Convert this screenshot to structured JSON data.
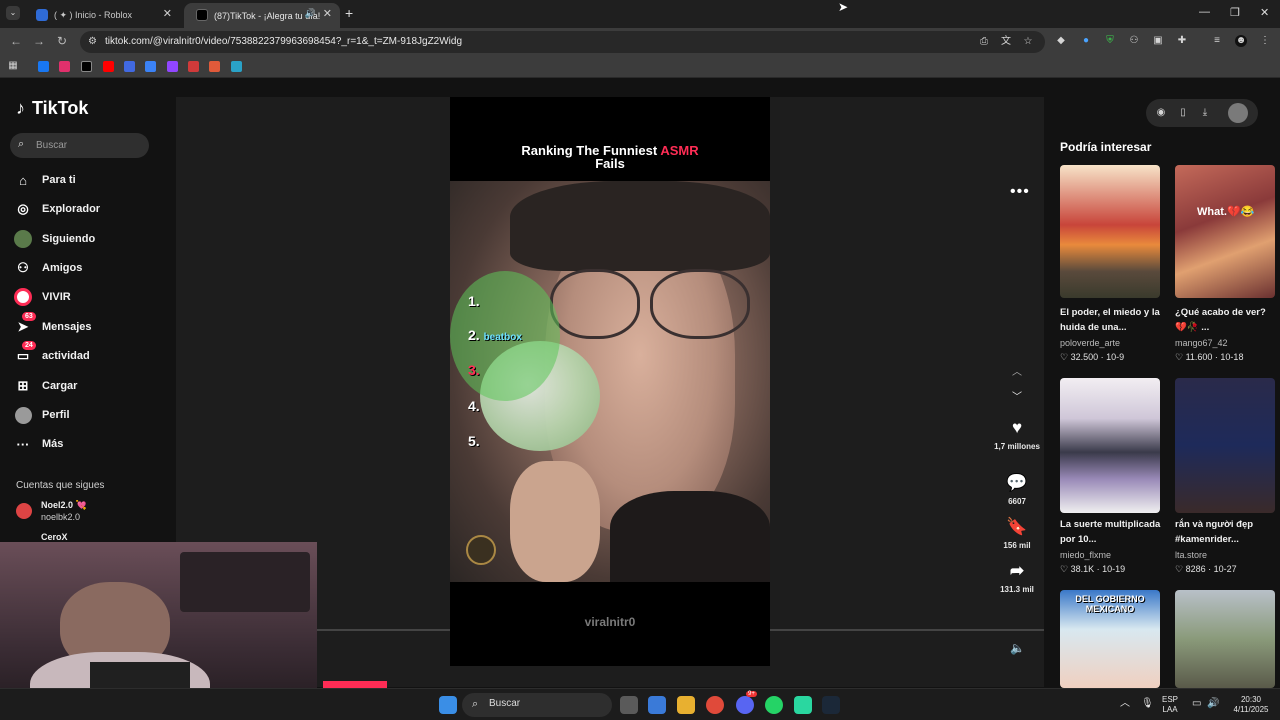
{
  "browser": {
    "tabs": [
      {
        "title": "( ✦ ) Inicio - Roblox",
        "fav_color": "#2f6bd6"
      },
      {
        "title": "(87)TikTok - ¡Alegra tu día!",
        "fav_color": "#000000"
      }
    ],
    "new_tab": "+",
    "url": "tiktok.com/@viralnitr0/video/7538822379963698454?_r=1&_t=ZM-918JgZ2Widg",
    "bookmark_colors": [
      "#1877f2",
      "#e1306c",
      "#000000",
      "#ff0000",
      "#4169e1",
      "#3b82f6",
      "#9146ff",
      "#d03a3a",
      "#e05a3a",
      "#2aa2c7"
    ]
  },
  "tiktok": {
    "logo": "TikTok",
    "search_placeholder": "Buscar",
    "nav": [
      {
        "label": "Para ti",
        "icon": "home-icon",
        "badge": ""
      },
      {
        "label": "Explorador",
        "icon": "compass-icon",
        "badge": ""
      },
      {
        "label": "Siguiendo",
        "icon": "following-icon",
        "badge": ""
      },
      {
        "label": "Amigos",
        "icon": "friends-icon",
        "badge": ""
      },
      {
        "label": "VIVIR",
        "icon": "live-icon",
        "badge": ""
      },
      {
        "label": "Mensajes",
        "icon": "send-icon",
        "badge": "63"
      },
      {
        "label": "actividad",
        "icon": "inbox-icon",
        "badge": "24"
      },
      {
        "label": "Cargar",
        "icon": "upload-icon",
        "badge": ""
      },
      {
        "label": "Perfil",
        "icon": "profile-icon",
        "badge": ""
      },
      {
        "label": "Más",
        "icon": "more-icon",
        "badge": ""
      }
    ],
    "following_title": "Cuentas que sigues",
    "following": [
      {
        "name": "Noel2.0 💘",
        "handle": "noelbk2.0"
      },
      {
        "name": "CeroX",
        "handle": ""
      }
    ],
    "video": {
      "title_part1": "Ranking The Funniest ",
      "title_highlight": "ASMR",
      "title_part2": "Fails",
      "ranks": [
        "1.",
        "2.",
        "3.",
        "4.",
        "5."
      ],
      "rank2_label": "beatbox",
      "watermark": "viralnitr0"
    },
    "actions": {
      "likes": "1,7 millones",
      "comments": "6607",
      "saves": "156 mil",
      "shares": "131.3 mil"
    },
    "right_title": "Podría interesar",
    "cards": [
      {
        "title": "El poder, el miedo y la huida de una...",
        "author": "poloverde_arte",
        "stats": "♡ 32.500 · 10-9",
        "caption": ""
      },
      {
        "title": "¿Qué acabo de ver? 💔🥀 ...",
        "author": "mango67_42",
        "stats": "♡ 11.600 · 10-18",
        "caption": "What.💔😂"
      },
      {
        "title": "La suerte multiplicada por 10...",
        "author": "miedo_flxme",
        "stats": "♡ 38.1K · 10-19",
        "caption": ""
      },
      {
        "title": "rắn và người đẹp #kamenrider...",
        "author": "lta.store",
        "stats": "♡ 8286 · 10-27",
        "caption": ""
      },
      {
        "title": "",
        "author": "",
        "stats": "",
        "caption": "DEL GOBIERNO MEXICANO"
      },
      {
        "title": "",
        "author": "",
        "stats": "",
        "caption": ""
      }
    ]
  },
  "taskbar": {
    "search_placeholder": "Buscar",
    "lang": "ESP",
    "lang2": "LAA",
    "time": "20:30",
    "date": "4/11/2025",
    "discord_badge": "9+"
  }
}
